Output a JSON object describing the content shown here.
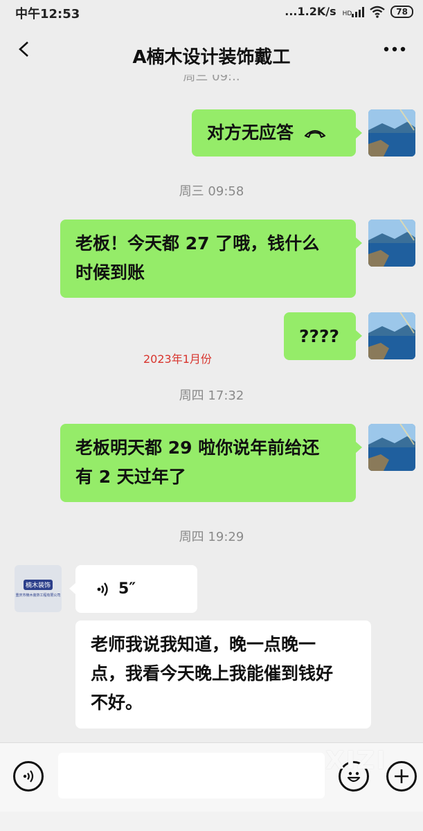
{
  "status_bar": {
    "time": "中午12:53",
    "net_speed": "...1.2K/s",
    "hd": "HD",
    "battery": "78"
  },
  "header": {
    "title": "A楠木设计装饰戴工",
    "back_icon": "chevron-left-icon",
    "more_icon": "more-dots-icon"
  },
  "clipped_timestamp": "周三 09:..",
  "messages": [
    {
      "sender": "me",
      "type": "call",
      "text": "对方无应答",
      "icon": "hangup-phone-icon"
    },
    {
      "type": "timestamp",
      "text": "周三 09:58"
    },
    {
      "sender": "me",
      "type": "text",
      "lines": [
        "老板！今天都 27 了哦，钱什么",
        "时候到账"
      ]
    },
    {
      "sender": "me",
      "type": "text",
      "text": "????"
    },
    {
      "type": "annotation",
      "text": "2023年1月份"
    },
    {
      "type": "timestamp",
      "text": "周四 17:32"
    },
    {
      "sender": "me",
      "type": "text",
      "lines": [
        "老板明天都 29 啦你说年前给还",
        "有 2 天过年了"
      ]
    },
    {
      "type": "timestamp",
      "text": "周四 19:29"
    },
    {
      "sender": "other",
      "type": "voice",
      "duration": "5″",
      "icon": "voice-wave-icon"
    },
    {
      "sender": "other",
      "type": "text",
      "lines": [
        "老师我说我知道，晚一点晚一",
        "点，我看今天晚上我能催到钱好",
        "不好。"
      ]
    }
  ],
  "company_avatar": {
    "logo_text": "楠木装饰",
    "company_name": "重庆市楠木装饰工程有限公司"
  },
  "bottom_bar": {
    "voice_icon": "voice-input-icon",
    "emoji_icon": "emoji-icon",
    "plus_icon": "plus-icon",
    "input_value": ""
  },
  "watermark": "XIZI",
  "colors": {
    "background": "#ededed",
    "my_bubble": "#95ec69",
    "their_bubble": "#ffffff",
    "annotation": "#d8342d"
  }
}
